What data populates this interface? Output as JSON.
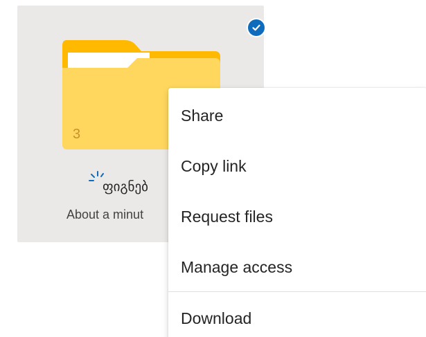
{
  "folder": {
    "count": "3",
    "name": "ფიგნებ",
    "modified": "About a minut",
    "selected": true
  },
  "menu": {
    "items": [
      {
        "label": "Share"
      },
      {
        "label": "Copy link"
      },
      {
        "label": "Request files"
      },
      {
        "label": "Manage access"
      },
      {
        "label": "Download"
      }
    ]
  },
  "colors": {
    "tile_background": "#ebe9e8",
    "folder_yellow": "#ffd75e",
    "folder_back": "#ffb900",
    "accent": "#0f6cbd"
  },
  "icons": [
    "check-circle-icon",
    "folder-icon",
    "sync-icon"
  ]
}
